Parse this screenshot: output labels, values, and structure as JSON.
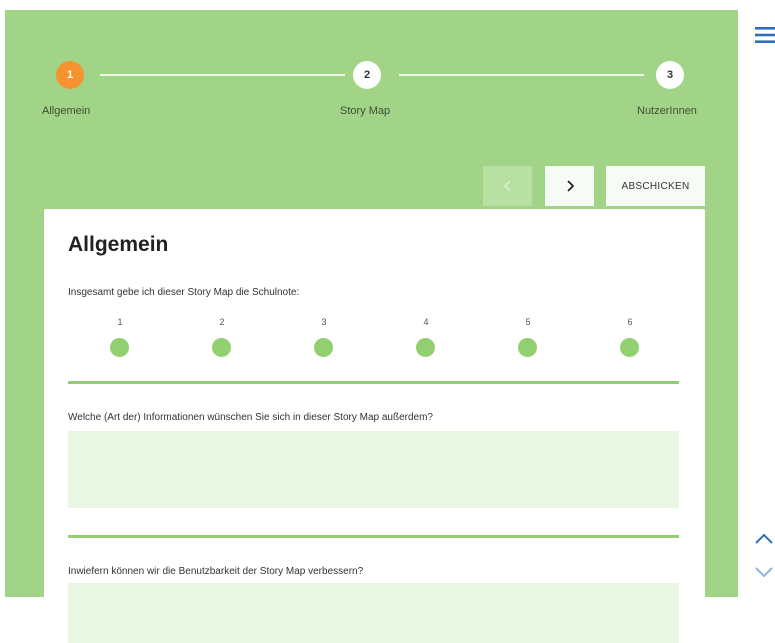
{
  "stepper": {
    "steps": [
      {
        "number": "1",
        "label": "Allgemein",
        "active": true
      },
      {
        "number": "2",
        "label": "Story Map",
        "active": false
      },
      {
        "number": "3",
        "label": "NutzerInnen",
        "active": false
      }
    ]
  },
  "nav": {
    "prev_icon": "chevron-left-icon",
    "next_icon": "chevron-right-icon",
    "submit_label": "ABSCHICKEN"
  },
  "form": {
    "title": "Allgemein",
    "question1": "Insgesamt gebe ich dieser Story Map die Schulnote:",
    "ratings": [
      "1",
      "2",
      "3",
      "4",
      "5",
      "6"
    ],
    "question2": "Welche (Art der) Informationen wünschen Sie sich in dieser Story Map außerdem?",
    "answer2": "",
    "question3": "Inwiefern können wir die Benutzbarkeit der Story Map verbessern?",
    "answer3": ""
  },
  "sidebar": {
    "menu_icon": "hamburger-menu-icon",
    "scroll_up_icon": "chevron-up-icon",
    "scroll_down_icon": "chevron-down-icon"
  },
  "colors": {
    "panel_bg": "#a1d487",
    "accent_green": "#92cf70",
    "active_step": "#f7932f",
    "icon_blue": "#2f6fb6"
  }
}
